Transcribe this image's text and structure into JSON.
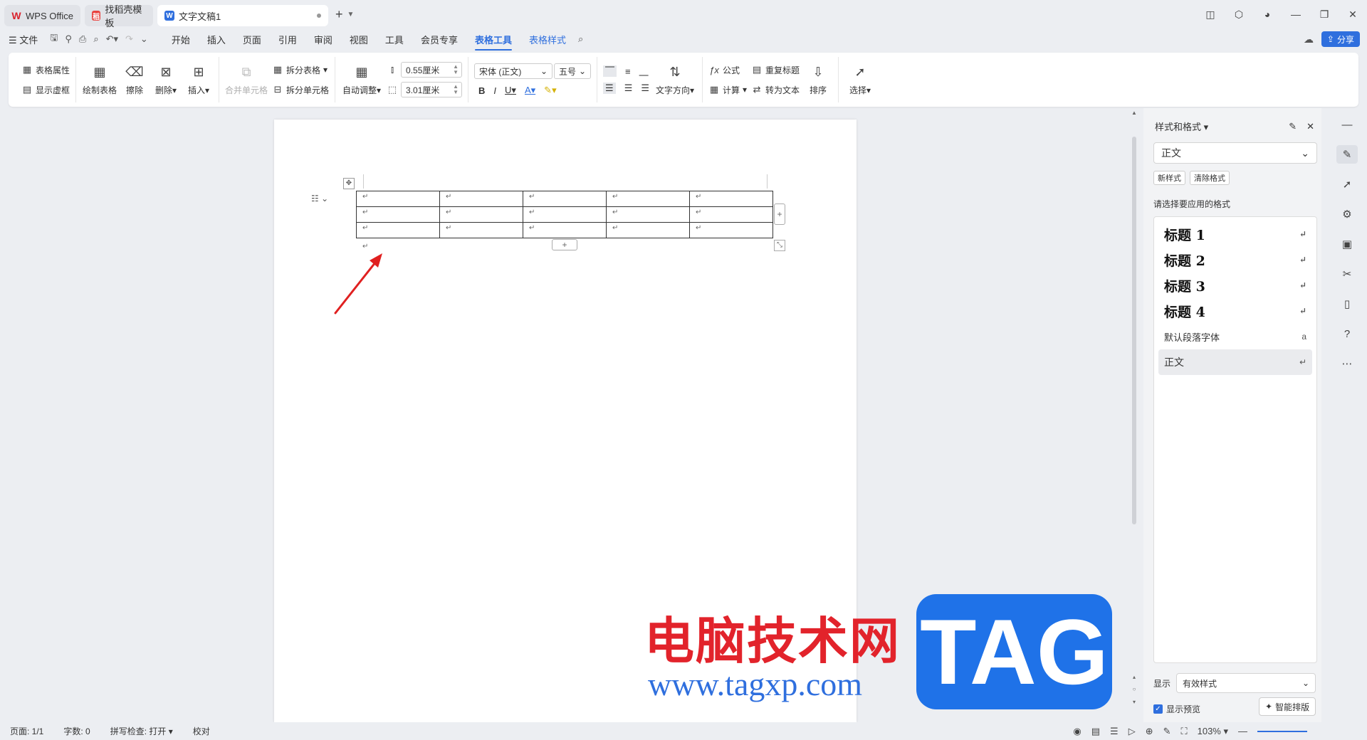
{
  "titlebar": {
    "tabs": [
      {
        "label": "WPS Office",
        "icon": "wps-logo-icon"
      },
      {
        "label": "找稻壳模板",
        "icon": "template-icon"
      },
      {
        "label": "文字文稿1",
        "icon": "word-doc-icon"
      }
    ]
  },
  "menubar": {
    "file": "文件",
    "items": [
      "开始",
      "插入",
      "页面",
      "引用",
      "审阅",
      "视图",
      "工具",
      "会员专享",
      "表格工具",
      "表格样式"
    ],
    "active": "表格工具",
    "share": "分享"
  },
  "ribbon": {
    "table_props": "表格属性",
    "show_gridlines": "显示虚框",
    "draw_table": "绘制表格",
    "erase": "擦除",
    "delete": "删除",
    "insert": "插入",
    "merge_cells": "合并单元格",
    "split_table": "拆分表格",
    "split_cells": "拆分单元格",
    "auto_fit": "自动调整",
    "row_height": "0.55厘米",
    "col_width": "3.01厘米",
    "font_name": "宋体 (正文)",
    "font_size": "五号",
    "text_direction": "文字方向",
    "formula": "公式",
    "calculate": "计算",
    "repeat_header": "重复标题",
    "convert_to_text": "转为文本",
    "sort": "排序",
    "select": "选择"
  },
  "document": {
    "table": {
      "rows": 3,
      "cols": 5,
      "cell_mark": "↵"
    },
    "para_mark": "↵"
  },
  "watermark": {
    "cn": "电脑技术网",
    "url": "www.tagxp.com",
    "tag": "TAG"
  },
  "panel": {
    "title": "样式和格式",
    "current_style": "正文",
    "new_style": "新样式",
    "clear_format": "清除格式",
    "choose_label": "请选择要应用的格式",
    "styles": [
      {
        "name": "标题  1",
        "kind": "heading"
      },
      {
        "name": "标题  2",
        "kind": "heading"
      },
      {
        "name": "标题  3",
        "kind": "heading"
      },
      {
        "name": "标题 4",
        "kind": "heading"
      },
      {
        "name": "默认段落字体",
        "kind": "char"
      },
      {
        "name": "正文",
        "kind": "selected"
      }
    ],
    "show_label": "显示",
    "show_value": "有效样式",
    "preview_label": "显示预览",
    "smart_layout": "智能排版"
  },
  "status": {
    "page": "页面: 1/1",
    "words": "字数: 0",
    "spellcheck": "拼写检查: 打开",
    "proofread": "校对",
    "zoom": "103%"
  },
  "colors": {
    "accent": "#2f6fde",
    "watermark_red": "#e2232b",
    "arrow_red": "#e02020"
  }
}
